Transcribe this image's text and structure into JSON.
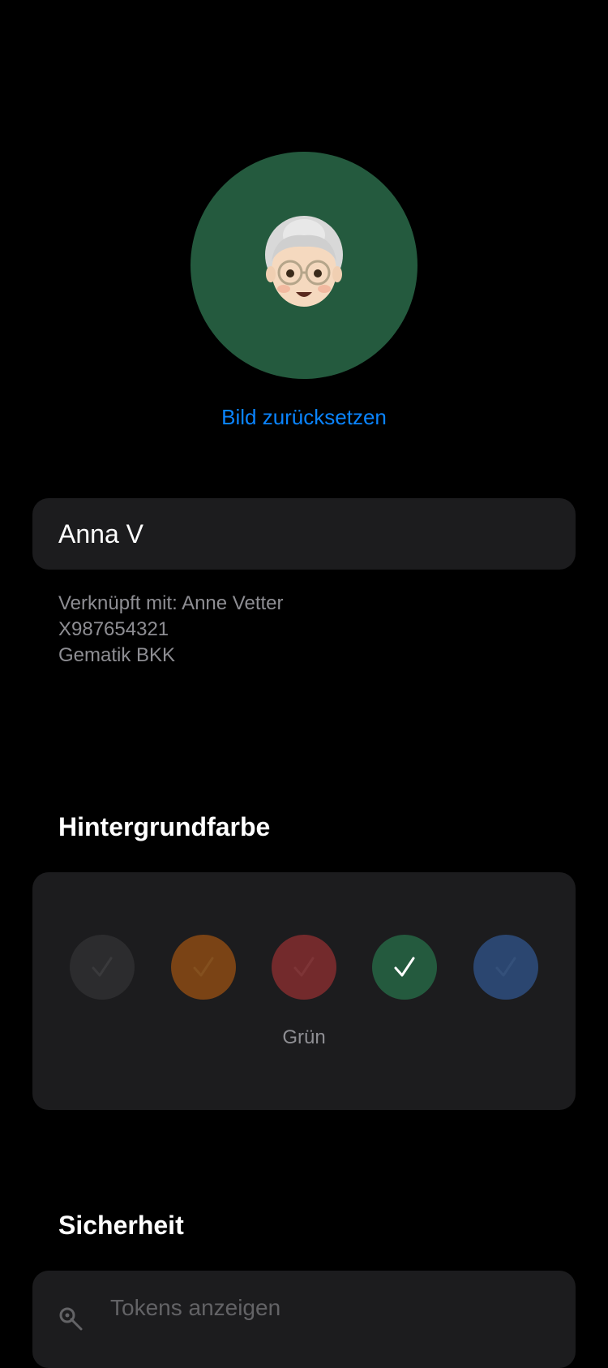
{
  "profile": {
    "avatar_icon": "grandmother-emoji-icon",
    "avatar_background": "#245a3e",
    "reset_image_label": "Bild zurücksetzen",
    "name_value": "Anna V",
    "linked_label": "Verknüpft mit: Anne Vetter",
    "insurance_number": "X987654321",
    "insurance_company": "Gematik BKK"
  },
  "background_color": {
    "title": "Hintergrundfarbe",
    "options": [
      {
        "name": "gray",
        "color": "#2c2c2e",
        "selected": false
      },
      {
        "name": "orange",
        "color": "#7a4315",
        "selected": false
      },
      {
        "name": "red",
        "color": "#732a2c",
        "selected": false
      },
      {
        "name": "green",
        "color": "#245a3e",
        "selected": true
      },
      {
        "name": "blue",
        "color": "#2b4670",
        "selected": false
      }
    ],
    "selected_name": "Grün",
    "accent": "#0a84ff"
  },
  "security": {
    "title": "Sicherheit",
    "items": [
      {
        "label": "Tokens anzeigen",
        "icon": "key-icon"
      }
    ]
  }
}
